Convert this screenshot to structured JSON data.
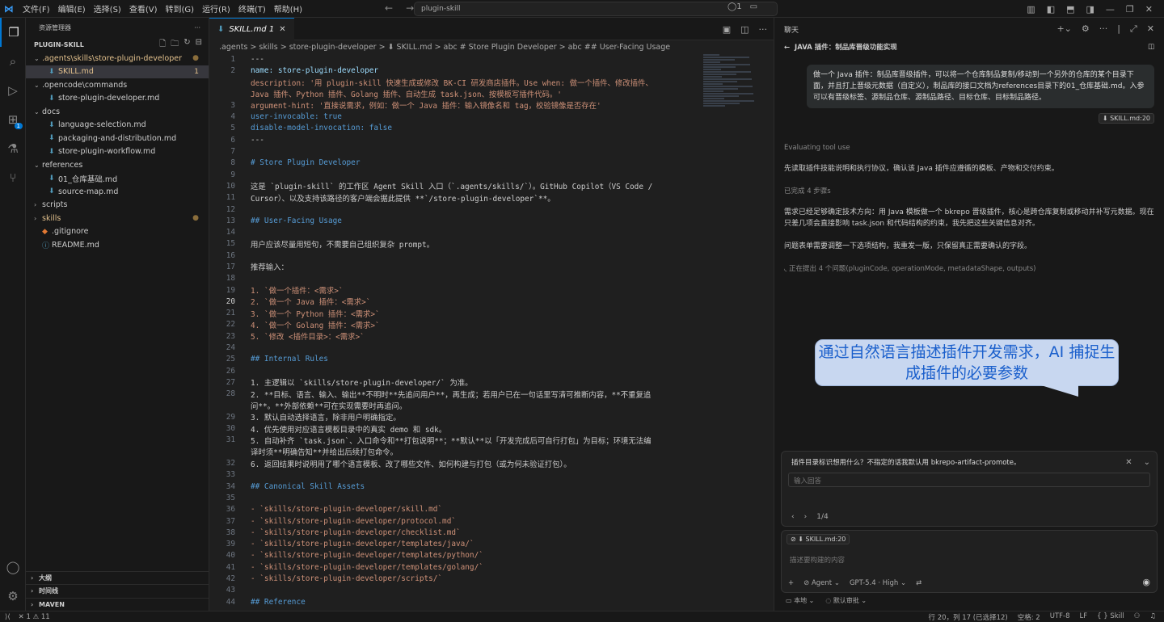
{
  "menu": [
    "文件(F)",
    "编辑(E)",
    "选择(S)",
    "查看(V)",
    "转到(G)",
    "运行(R)",
    "终端(T)",
    "帮助(H)"
  ],
  "search_text": "plugin-skill",
  "cmd_right": "◯1",
  "sidebar": {
    "title": "资源管理器",
    "project": "PLUGIN-SKILL",
    "items": [
      {
        "label": ".agents\\skills\\store-plugin-developer",
        "indent": 0,
        "type": "folder-open",
        "status": "●",
        "statusColor": "#8a6d3b",
        "color": "#e2c08d"
      },
      {
        "label": "SKILL.md",
        "indent": 1,
        "type": "file",
        "status": "1",
        "statusColor": "#e2c08d",
        "color": "#e2c08d",
        "selected": true
      },
      {
        "label": ".opencode\\commands",
        "indent": 0,
        "type": "folder-open",
        "status": "",
        "color": "#ccc"
      },
      {
        "label": "store-plugin-developer.md",
        "indent": 1,
        "type": "file",
        "status": "",
        "color": "#ccc"
      },
      {
        "label": "docs",
        "indent": 0,
        "type": "folder-open",
        "status": "",
        "color": "#ccc"
      },
      {
        "label": "language-selection.md",
        "indent": 1,
        "type": "file",
        "status": "",
        "color": "#ccc"
      },
      {
        "label": "packaging-and-distribution.md",
        "indent": 1,
        "type": "file",
        "status": "",
        "color": "#ccc"
      },
      {
        "label": "store-plugin-workflow.md",
        "indent": 1,
        "type": "file",
        "status": "",
        "color": "#ccc"
      },
      {
        "label": "references",
        "indent": 0,
        "type": "folder-open",
        "status": "",
        "color": "#ccc"
      },
      {
        "label": "01_仓库基础.md",
        "indent": 1,
        "type": "file",
        "status": "",
        "color": "#ccc"
      },
      {
        "label": "source-map.md",
        "indent": 1,
        "type": "file",
        "status": "",
        "color": "#ccc"
      },
      {
        "label": "scripts",
        "indent": 0,
        "type": "folder",
        "status": "",
        "color": "#ccc"
      },
      {
        "label": "skills",
        "indent": 0,
        "type": "folder",
        "status": "●",
        "statusColor": "#8a6d3b",
        "color": "#e2c08d"
      },
      {
        "label": ".gitignore",
        "indent": 0,
        "type": "plain",
        "status": "",
        "color": "#ccc"
      },
      {
        "label": "README.md",
        "indent": 0,
        "type": "info",
        "status": "",
        "color": "#ccc"
      }
    ],
    "bottom": [
      "大纲",
      "时间线",
      "MAVEN"
    ]
  },
  "editor": {
    "tab_label": "SKILL.md 1",
    "crumbs": ".agents > skills > store-plugin-developer > ⬇ SKILL.md > abc # Store Plugin Developer > abc ## User-Facing Usage",
    "lines": [
      {
        "n": "1",
        "t": "---",
        "c": "#ccc"
      },
      {
        "n": "2",
        "t": "name: store-plugin-developer",
        "c": "#9cdcfe"
      },
      {
        "n": "",
        "t": "description: '用 plugin-skill 快速生成或修改 BK-CI 研发商店插件。Use when: 做一个插件、修改插件、",
        "c": "#ce9178"
      },
      {
        "n": "",
        "t": "Java 插件、Python 插件、Golang 插件、自动生成 task.json、按模板写插件代码。'",
        "c": "#ce9178"
      },
      {
        "n": "3",
        "t": "argument-hint: '直接说需求，例如：做一个 Java 插件：输入镜像名和 tag，校验镜像是否存在'",
        "c": "#ce9178"
      },
      {
        "n": "4",
        "t": "user-invocable: true",
        "c": "#569cd6"
      },
      {
        "n": "5",
        "t": "disable-model-invocation: false",
        "c": "#569cd6"
      },
      {
        "n": "6",
        "t": "---",
        "c": "#ccc"
      },
      {
        "n": "7",
        "t": "",
        "c": "#ccc"
      },
      {
        "n": "8",
        "t": "# Store Plugin Developer",
        "c": "#569cd6"
      },
      {
        "n": "9",
        "t": "",
        "c": "#ccc"
      },
      {
        "n": "10",
        "t": "这是 `plugin-skill` 的工作区 Agent Skill 入口（`.agents/skills/`）。GitHub Copilot（VS Code /",
        "c": "#ccc"
      },
      {
        "n": "11",
        "t": "Cursor）、以及支持该路径的客户端会据此提供 **`/store-plugin-developer`**。",
        "c": "#ccc"
      },
      {
        "n": "12",
        "t": "",
        "c": "#ccc"
      },
      {
        "n": "13",
        "t": "## User-Facing Usage",
        "c": "#569cd6"
      },
      {
        "n": "14",
        "t": "",
        "c": "#ccc"
      },
      {
        "n": "15",
        "t": "用户应该尽量用短句，不需要自己组织复杂 prompt。",
        "c": "#ccc"
      },
      {
        "n": "16",
        "t": "",
        "c": "#ccc"
      },
      {
        "n": "17",
        "t": "推荐输入：",
        "c": "#ccc"
      },
      {
        "n": "18",
        "t": "",
        "c": "#ccc"
      },
      {
        "n": "19",
        "t": "1. `做一个插件：<需求>`",
        "c": "#ce9178"
      },
      {
        "n": "20",
        "t": "2. `做一个 Java 插件：<需求>`",
        "c": "#ce9178",
        "cur": true
      },
      {
        "n": "21",
        "t": "3. `做一个 Python 插件：<需求>`",
        "c": "#ce9178"
      },
      {
        "n": "22",
        "t": "4. `做一个 Golang 插件：<需求>`",
        "c": "#ce9178"
      },
      {
        "n": "23",
        "t": "5. `修改 <插件目录>：<需求>`",
        "c": "#ce9178"
      },
      {
        "n": "24",
        "t": "",
        "c": "#ccc"
      },
      {
        "n": "25",
        "t": "## Internal Rules",
        "c": "#569cd6"
      },
      {
        "n": "26",
        "t": "",
        "c": "#ccc"
      },
      {
        "n": "27",
        "t": "1. 主逻辑以 `skills/store-plugin-developer/` 为准。",
        "c": "#ccc"
      },
      {
        "n": "28",
        "t": "2. **目标、语言、输入、输出**不明时**先追问用户**，再生成；若用户已在一句话里写清可推断内容，**不重复追",
        "c": "#ccc"
      },
      {
        "n": "",
        "t": "问**。**外部依赖**可在实现需要时再追问。",
        "c": "#ccc"
      },
      {
        "n": "29",
        "t": "3. 默认自动选择语言，除非用户明确指定。",
        "c": "#ccc"
      },
      {
        "n": "30",
        "t": "4. 优先使用对应语言模板目录中的真实 demo 和 sdk。",
        "c": "#ccc"
      },
      {
        "n": "31",
        "t": "5. 自动补齐 `task.json`、入口命令和**打包说明**；**默认**以「开发完成后可自行打包」为目标；环境无法编",
        "c": "#ccc"
      },
      {
        "n": "",
        "t": "译时须**明确告知**并给出后续打包命令。",
        "c": "#ccc"
      },
      {
        "n": "32",
        "t": "6. 返回结果时说明用了哪个语言模板、改了哪些文件、如何构建与打包（或为何未验证打包）。",
        "c": "#ccc"
      },
      {
        "n": "33",
        "t": "",
        "c": "#ccc"
      },
      {
        "n": "34",
        "t": "## Canonical Skill Assets",
        "c": "#569cd6"
      },
      {
        "n": "35",
        "t": "",
        "c": "#ccc"
      },
      {
        "n": "36",
        "t": "- `skills/store-plugin-developer/skill.md`",
        "c": "#ce9178"
      },
      {
        "n": "37",
        "t": "- `skills/store-plugin-developer/protocol.md`",
        "c": "#ce9178"
      },
      {
        "n": "38",
        "t": "- `skills/store-plugin-developer/checklist.md`",
        "c": "#ce9178"
      },
      {
        "n": "39",
        "t": "- `skills/store-plugin-developer/templates/java/`",
        "c": "#ce9178"
      },
      {
        "n": "40",
        "t": "- `skills/store-plugin-developer/templates/python/`",
        "c": "#ce9178"
      },
      {
        "n": "41",
        "t": "- `skills/store-plugin-developer/templates/golang/`",
        "c": "#ce9178"
      },
      {
        "n": "42",
        "t": "- `skills/store-plugin-developer/scripts/`",
        "c": "#ce9178"
      },
      {
        "n": "43",
        "t": "",
        "c": "#ccc"
      },
      {
        "n": "44",
        "t": "## Reference",
        "c": "#569cd6"
      }
    ]
  },
  "chat": {
    "title": "聊天",
    "session": "JAVA 插件：制品库晋级功能实现",
    "user_message": "做一个 Java 插件：制品库晋级插件，可以将一个仓库制品复制/移动到一个另外的仓库的某个目录下面，并且打上晋级元数据（自定义），制品库的接口文档为references目录下的01_仓库基础.md。入参可以有晋级标签、源制品仓库、源制品路径、目标仓库、目标制品路径。",
    "user_ref": "⬇ SKILL.md:20",
    "evaluating": "Evaluating tool use",
    "p1": "先读取插件技能说明和执行协议，确认该 Java 插件应遵循的模板、产物和交付约束。",
    "done": "已完成 4 步骤s",
    "p2": "需求已经足够确定技术方向：用 Java 模板做一个 bkrepo 晋级插件，核心是跨仓库复制或移动并补写元数据。现在只差几项会直接影响 task.json 和代码结构的约束，我先把这些关键信息对齐。",
    "p3": "问题表单需要调整一下选项结构，我重发一版，只保留真正需要确认的字段。",
    "asking": "正在提出 4 个问题(pluginCode, operationMode, metadataShape, outputs)",
    "callout": "通过自然语言描述插件开发需求，AI 捕捉生成插件的必要参数",
    "question": "插件目录标识想用什么？不指定的话我默认用 bkrepo-artifact-promote。",
    "answer_placeholder": "输入回答",
    "pager": "1/4",
    "input_ref": "⬇ SKILL.md:20",
    "input_placeholder": "描述要构建的内容",
    "agent": "Agent",
    "model": "GPT-5.4 · High",
    "foot_local": "本地",
    "foot_approve": "默认审批"
  },
  "status": {
    "left": "✕ 1 ⚠ 11",
    "pos": "行 20，列 17 (已选择12)",
    "spaces": "空格: 2",
    "enc": "UTF-8",
    "eol": "LF",
    "lang": "{ } Skill"
  }
}
